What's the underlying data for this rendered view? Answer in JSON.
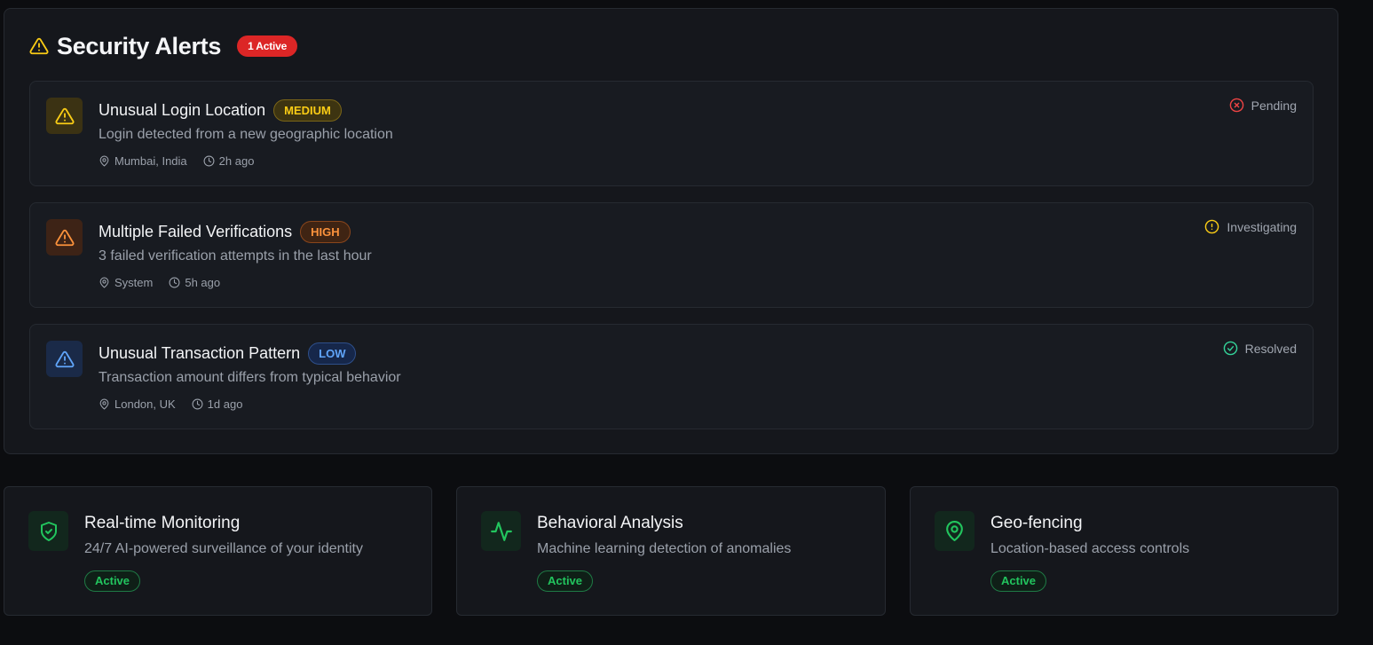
{
  "alerts_panel": {
    "title": "Security Alerts",
    "active_badge": "1 Active",
    "header_icon": "warning-triangle-icon"
  },
  "alerts": [
    {
      "title": "Unusual Login Location",
      "severity": "MEDIUM",
      "description": "Login detected from a new geographic location",
      "location": "Mumbai, India",
      "time": "2h ago",
      "status": "Pending",
      "status_icon": "x-circle-icon",
      "icon": "warning-triangle-icon",
      "accent_color": "#facc15"
    },
    {
      "title": "Multiple Failed Verifications",
      "severity": "HIGH",
      "description": "3 failed verification attempts in the last hour",
      "location": "System",
      "time": "5h ago",
      "status": "Investigating",
      "status_icon": "alert-circle-icon",
      "icon": "warning-triangle-icon",
      "accent_color": "#fb923c"
    },
    {
      "title": "Unusual Transaction Pattern",
      "severity": "LOW",
      "description": "Transaction amount differs from typical behavior",
      "location": "London, UK",
      "time": "1d ago",
      "status": "Resolved",
      "status_icon": "check-circle-icon",
      "icon": "warning-triangle-icon",
      "accent_color": "#60a5fa"
    }
  ],
  "features": [
    {
      "title": "Real-time Monitoring",
      "description": "24/7 AI-powered surveillance of your identity",
      "status": "Active",
      "icon": "shield-check-icon"
    },
    {
      "title": "Behavioral Analysis",
      "description": "Machine learning detection of anomalies",
      "status": "Active",
      "icon": "activity-pulse-icon"
    },
    {
      "title": "Geo-fencing",
      "description": "Location-based access controls",
      "status": "Active",
      "icon": "map-pin-icon"
    }
  ],
  "colors": {
    "background": "#0c0d10",
    "panel": "#15171c",
    "danger": "#dc2626",
    "medium": "#facc15",
    "high": "#fb923c",
    "low": "#60a5fa",
    "success": "#22c55e",
    "resolved": "#34d399"
  }
}
